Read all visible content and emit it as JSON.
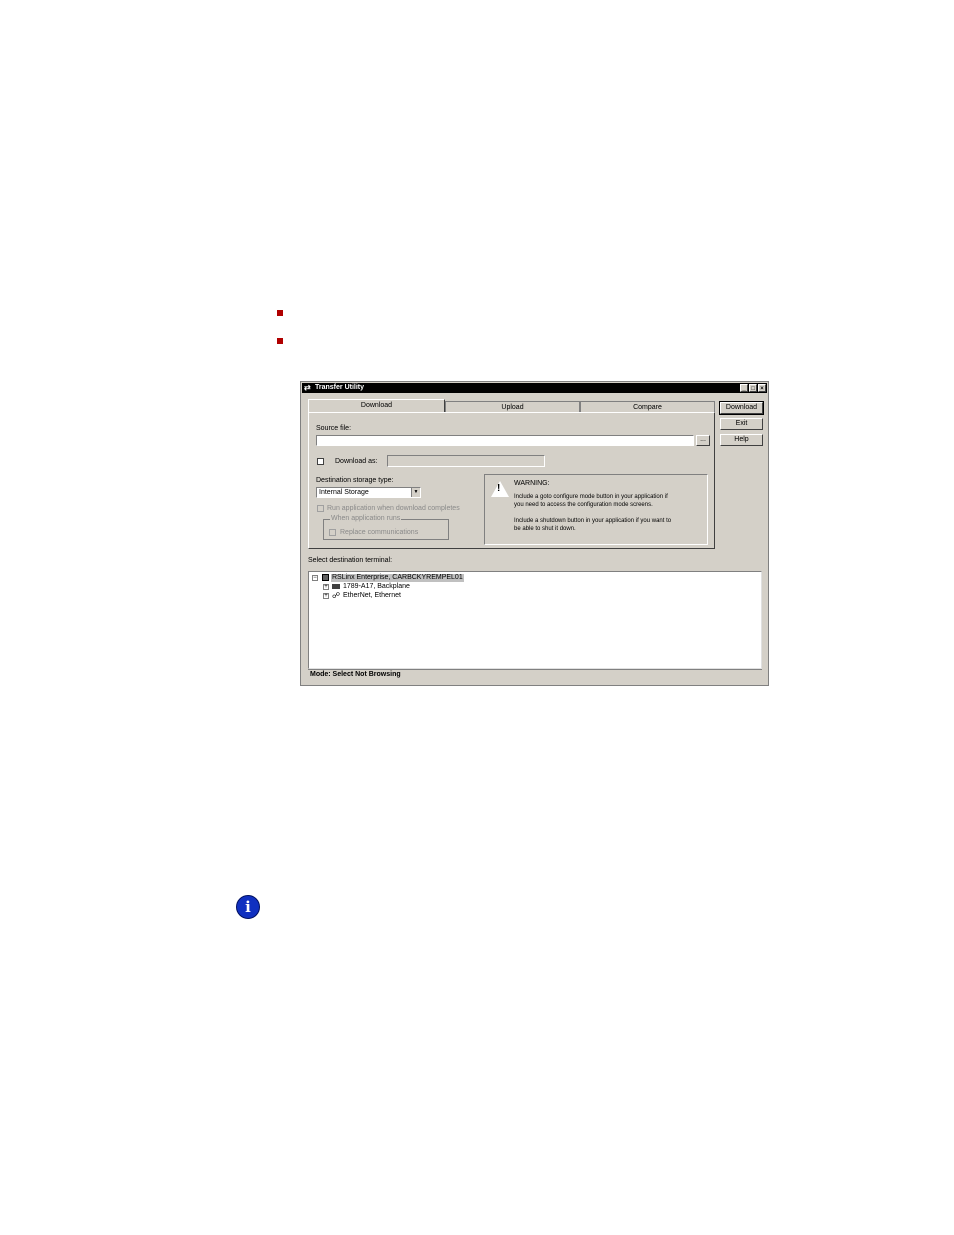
{
  "window": {
    "title": "Transfer Utility",
    "min_symbol": "_",
    "max_symbol": "□",
    "close_symbol": "×"
  },
  "tabs": [
    "Download",
    "Upload",
    "Compare"
  ],
  "buttons": {
    "download": "Download",
    "exit": "Exit",
    "help": "Help",
    "browse": "..."
  },
  "form": {
    "source_file_label": "Source file:",
    "source_file_value": "",
    "download_as_label": "Download as:",
    "download_as_value": "",
    "dest_storage_label": "Destination storage type:",
    "dest_storage_value": "Internal Storage",
    "run_app_label": "Run application when download completes",
    "when_app_runs_label": "When application runs",
    "replace_comm_label": "Replace communications"
  },
  "warning": {
    "title": "WARNING:",
    "line1": "Include a goto configure mode button in your application if",
    "line2": "you need to access the configuration mode screens.",
    "line3": "Include a shutdown button in your application if you want to",
    "line4": "be able to shut it down."
  },
  "tree": {
    "label": "Select destination terminal:",
    "root": "RSLinx Enterprise, CARBCKYREMPEL01",
    "child1": "1789-A17, Backplane",
    "child2": "EtherNet, Ethernet"
  },
  "status": "Mode: Select Not Browsing",
  "colors": {
    "bullet": "#b00000",
    "window_face": "#d4d0c8",
    "titlebar": "#000000",
    "info_icon": "#1030c0"
  }
}
